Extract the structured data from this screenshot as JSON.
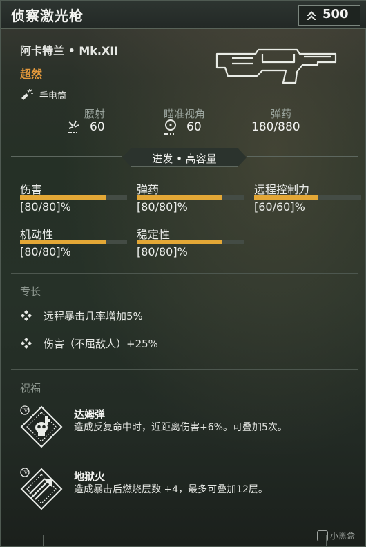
{
  "header": {
    "title": "侦察激光枪",
    "power": "500"
  },
  "weapon": {
    "manufacturer": "阿卡特兰 • Mk.XII",
    "rarity": "超然",
    "attachment": {
      "label": "手电筒",
      "icon": "flashlight-icon"
    },
    "image_icon": "lasgun-icon"
  },
  "stats": [
    {
      "label": "腰射",
      "value": "60",
      "icon": "hipfire-icon"
    },
    {
      "label": "瞄准视角",
      "value": "60",
      "icon": "aim-icon"
    },
    {
      "label": "弹药",
      "value": "180/880"
    }
  ],
  "fire_mode": "进发 • 高容量",
  "attributes": [
    {
      "label": "伤害",
      "value": "[80/80]%",
      "level": 0.8
    },
    {
      "label": "弹药",
      "value": "[80/80]%",
      "level": 0.8
    },
    {
      "label": "远程控制力",
      "value": "[60/60]%",
      "level": 0.6
    },
    {
      "label": "机动性",
      "value": "[80/80]%",
      "level": 0.8
    },
    {
      "label": "稳定性",
      "value": "[80/80]%",
      "level": 0.8
    }
  ],
  "perks": {
    "section_label": "专长",
    "items": [
      {
        "text": "远程暴击几率增加5%"
      },
      {
        "text": "伤害（不屈敌人）+25%"
      }
    ]
  },
  "blessings": {
    "section_label": "祝福",
    "items": [
      {
        "tier": "IV",
        "name": "达姆弹",
        "description": "造成反复命中时，近距离伤害+6%。可叠加5次。",
        "icon": "skull-blessing-icon"
      },
      {
        "tier": "IV",
        "name": "地狱火",
        "description": "造成暴击后燃烧层数 +4，最多可叠加12层。",
        "icon": "arrow-blessing-icon"
      }
    ]
  },
  "watermark": "小黑盒",
  "colors": {
    "accent": "#e3a736",
    "rarity": "#e69a3c",
    "bar_track": "#444c45"
  }
}
